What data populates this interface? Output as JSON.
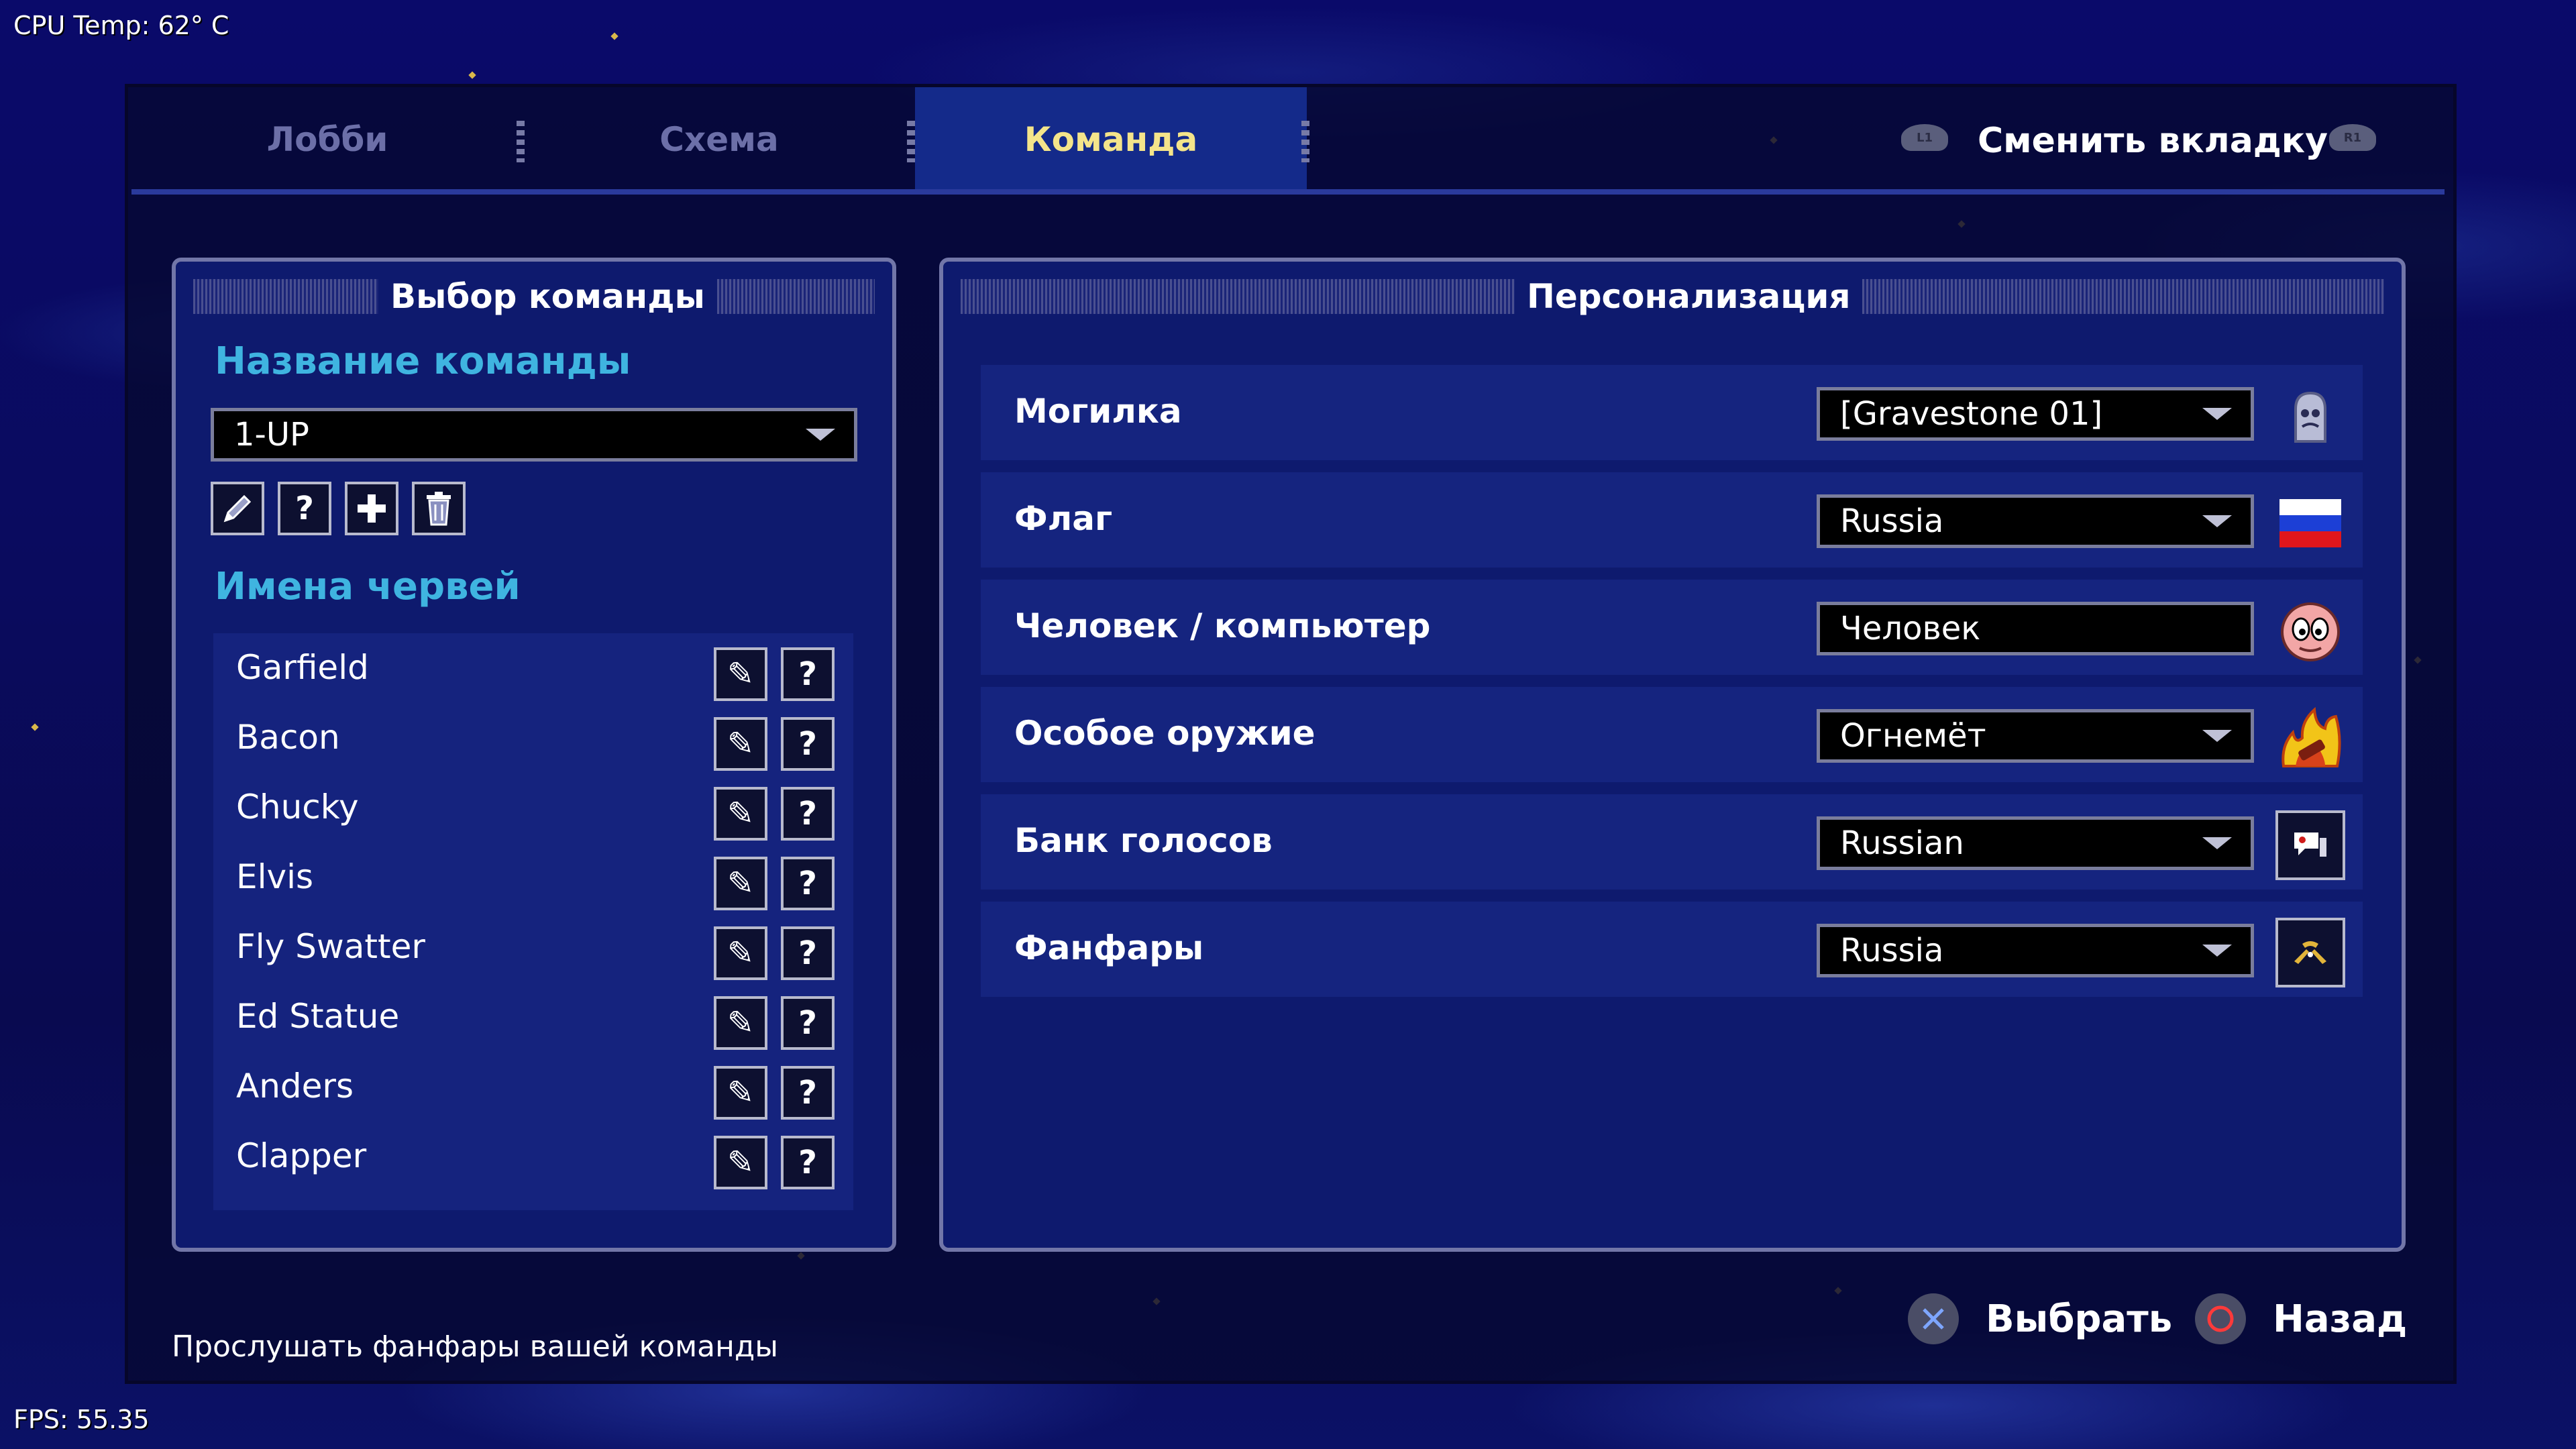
{
  "hud": {
    "cpu_temp": "CPU Temp: 62° C",
    "fps": "FPS: 55.35"
  },
  "tabs": [
    {
      "label": "Лобби",
      "active": false
    },
    {
      "label": "Схема",
      "active": false
    },
    {
      "label": "Команда",
      "active": true
    }
  ],
  "tab_switch": {
    "label": "Сменить вкладку",
    "left_button": "L1",
    "right_button": "R1"
  },
  "team_panel": {
    "title": "Выбор команды",
    "team_name_label": "Название команды",
    "selected_team": "1-UP",
    "worms_label": "Имена червей",
    "worms": [
      "Garfield",
      "Bacon",
      "Chucky",
      "Elvis",
      "Fly Swatter",
      "Ed Statue",
      "Anders",
      "Clapper"
    ]
  },
  "personalization": {
    "title": "Персонализация",
    "rows": [
      {
        "label": "Могилка",
        "value": "[Gravestone 01]",
        "icon": "gravestone-icon",
        "dropdown": true
      },
      {
        "label": "Флаг",
        "value": "Russia",
        "icon": "russia-flag-icon",
        "dropdown": true
      },
      {
        "label": "Человек / компьютер",
        "value": "Человек",
        "icon": "worm-face-icon",
        "dropdown": false
      },
      {
        "label": "Особое оружие",
        "value": "Огнемёт",
        "icon": "flamethrower-icon",
        "dropdown": true
      },
      {
        "label": "Банк голосов",
        "value": "Russian",
        "icon": "speech-bubble-icon",
        "dropdown": true
      },
      {
        "label": "Фанфары",
        "value": "Russia",
        "icon": "fanfare-icon",
        "dropdown": true
      }
    ]
  },
  "footer": {
    "hint": "Прослушать фанфары вашей команды",
    "select_label": "Выбрать",
    "back_label": "Назад"
  },
  "colors": {
    "accent_cyan": "#3fb4e0",
    "active_tab_text": "#f4e48a",
    "panel_bg": "#0e1a6e"
  }
}
